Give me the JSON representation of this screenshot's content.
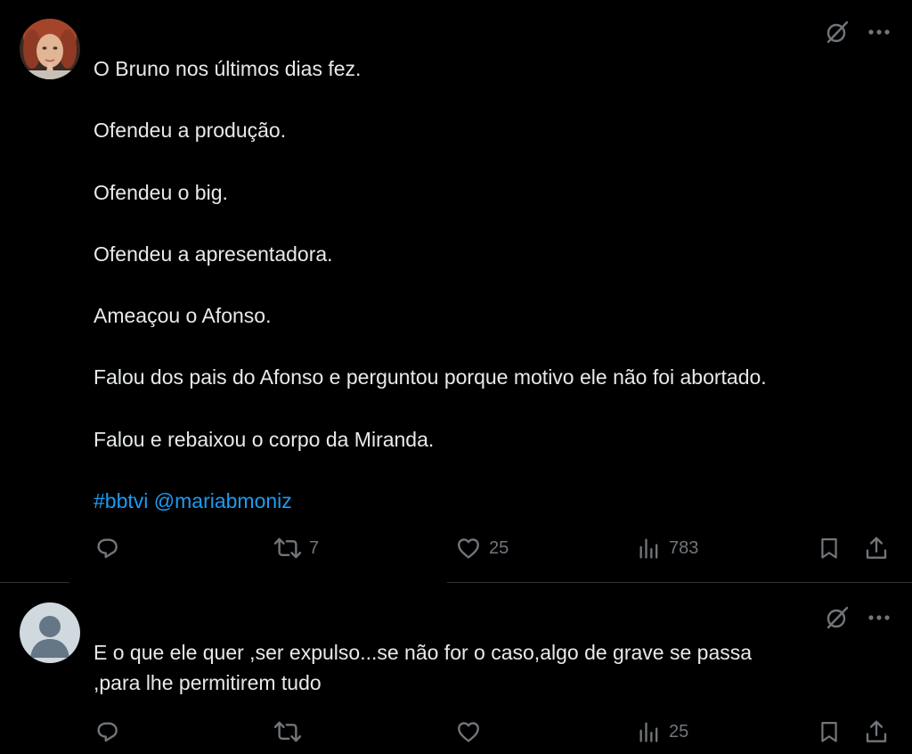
{
  "tweets": [
    {
      "lines": [
        "O Bruno nos últimos dias fez.",
        "Ofendeu a produção.",
        "Ofendeu o big.",
        "Ofendeu a apresentadora.",
        "Ameaçou o Afonso.",
        "Falou dos pais do Afonso e perguntou porque motivo ele não foi abortado.",
        "Falou e rebaixou o corpo da Miranda."
      ],
      "hashtag": "#bbtvi",
      "mention": "@mariabmoniz",
      "replies": "",
      "retweets": "7",
      "likes": "25",
      "views": "783"
    },
    {
      "lines": [
        "E o que ele quer ,ser expulso...se não for o caso,algo de grave se passa",
        ",para lhe permitirem tudo"
      ],
      "replies": "",
      "retweets": "",
      "likes": "",
      "views": "25"
    }
  ],
  "icons": [
    "grok-icon",
    "more-icon",
    "reply-icon",
    "retweet-icon",
    "like-icon",
    "views-icon",
    "bookmark-icon",
    "share-icon"
  ],
  "colors": {
    "background": "#000000",
    "text": "#e7e9ea",
    "muted": "#71767b",
    "link": "#1d9bf0",
    "divider": "#2f3336"
  }
}
